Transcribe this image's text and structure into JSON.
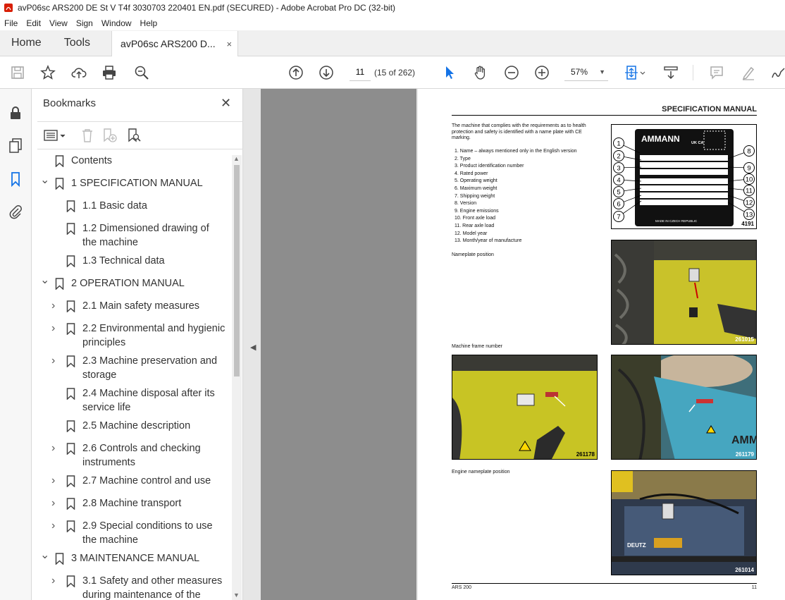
{
  "window": {
    "title": "avP06sc ARS200 DE St V T4f 3030703 220401 EN.pdf (SECURED) - Adobe Acrobat Pro DC (32-bit)"
  },
  "menu": [
    "File",
    "Edit",
    "View",
    "Sign",
    "Window",
    "Help"
  ],
  "tabs": {
    "home": "Home",
    "tools": "Tools",
    "document": "avP06sc ARS200 D...",
    "close": "×"
  },
  "toolbar": {
    "page_value": "11",
    "page_count": "(15 of 262)",
    "zoom": "57%"
  },
  "bookmarks": {
    "title": "Bookmarks",
    "items": [
      {
        "label": "Contents",
        "level": 0,
        "twisty": ""
      },
      {
        "label": "1 SPECIFICATION MANUAL",
        "level": 0,
        "twisty": "open"
      },
      {
        "label": "1.1 Basic data",
        "level": 1,
        "twisty": ""
      },
      {
        "label": "1.2 Dimensioned drawing of",
        "label2": "the machine",
        "level": 1,
        "twisty": ""
      },
      {
        "label": "1.3 Technical data",
        "level": 1,
        "twisty": ""
      },
      {
        "label": "2 OPERATION MANUAL",
        "level": 0,
        "twisty": "open"
      },
      {
        "label": "2.1 Main safety measures",
        "level": 1,
        "twisty": "closed"
      },
      {
        "label": "2.2 Environmental and hygienic",
        "label2": "principles",
        "level": 1,
        "twisty": "closed"
      },
      {
        "label": "2.3 Machine preservation and",
        "label2": "storage",
        "level": 1,
        "twisty": "closed"
      },
      {
        "label": "2.4 Machine disposal after its",
        "label2": "service life",
        "level": 1,
        "twisty": ""
      },
      {
        "label": "2.5 Machine description",
        "level": 1,
        "twisty": ""
      },
      {
        "label": "2.6 Controls and checking",
        "label2": "instruments",
        "level": 1,
        "twisty": "closed"
      },
      {
        "label": "2.7 Machine control and use",
        "level": 1,
        "twisty": "closed"
      },
      {
        "label": "2.8 Machine transport",
        "level": 1,
        "twisty": "closed"
      },
      {
        "label": "2.9 Special conditions to use",
        "label2": "the machine",
        "level": 1,
        "twisty": "closed"
      },
      {
        "label": "3 MAINTENANCE MANUAL",
        "level": 0,
        "twisty": "open"
      },
      {
        "label": "3.1 Safety and other measures",
        "label2": "during maintenance of the",
        "level": 1,
        "twisty": "closed"
      }
    ]
  },
  "pdf": {
    "header": "SPECIFICATION MANUAL",
    "intro": "The machine that complies with the requirements as to health protection and safety is identified with a name plate with CE marking.",
    "list": [
      "1. Name – always mentioned only in the English version",
      "2. Type",
      "3. Product identification number",
      "4. Rated power",
      "5. Operating weight",
      "6. Maximum weight",
      "7. Shipping weight",
      "8. Version",
      "9. Engine emissions",
      "10. Front axle load",
      "11. Rear axle load",
      "12. Model year",
      "13. Month/year of manufacture"
    ],
    "caption_nameplate": "Nameplate position",
    "caption_frame": "Machine frame number",
    "caption_engine": "Engine nameplate position",
    "plate": {
      "brand": "AMMANN",
      "uk_ca": "UK CA",
      "made_in": "MADE IN CZECH REPUBLIC",
      "fig": "4191",
      "callouts": [
        "1",
        "2",
        "3",
        "4",
        "5",
        "6",
        "7",
        "8",
        "9",
        "10",
        "11",
        "12",
        "13"
      ]
    },
    "photo_nums": [
      "261015",
      "261178",
      "261179",
      "261014"
    ],
    "photo_brands": {
      "ammann": "AMM",
      "deutz": "DEUTZ"
    },
    "footer_left": "ARS 200",
    "footer_right": "11"
  }
}
